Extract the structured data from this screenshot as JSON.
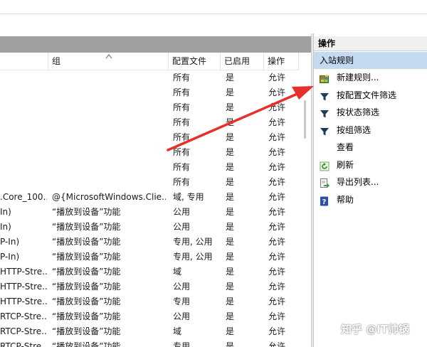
{
  "columns": {
    "group": "组",
    "profile": "配置文件",
    "enabled": "已启用",
    "action": "操作"
  },
  "rows": [
    {
      "name": "",
      "group": "",
      "profile": "所有",
      "enabled": "是",
      "action": "允许"
    },
    {
      "name": "",
      "group": "",
      "profile": "所有",
      "enabled": "是",
      "action": "允许"
    },
    {
      "name": "",
      "group": "",
      "profile": "所有",
      "enabled": "是",
      "action": "允许"
    },
    {
      "name": "",
      "group": "",
      "profile": "所有",
      "enabled": "是",
      "action": "允许"
    },
    {
      "name": "",
      "group": "",
      "profile": "所有",
      "enabled": "是",
      "action": "允许"
    },
    {
      "name": "",
      "group": "",
      "profile": "所有",
      "enabled": "是",
      "action": "允许"
    },
    {
      "name": "",
      "group": "",
      "profile": "所有",
      "enabled": "是",
      "action": "允许"
    },
    {
      "name": "",
      "group": "",
      "profile": "所有",
      "enabled": "是",
      "action": "允许"
    },
    {
      "name": ".Core_100...",
      "group": "@{MicrosoftWindows.Clie...",
      "profile": "域, 专用",
      "enabled": "是",
      "action": "允许"
    },
    {
      "name": "In)",
      "group": "“播放到设备”功能",
      "profile": "公用",
      "enabled": "是",
      "action": "允许"
    },
    {
      "name": "In)",
      "group": "“播放到设备”功能",
      "profile": "公用",
      "enabled": "是",
      "action": "允许"
    },
    {
      "name": "P-In)",
      "group": "“播放到设备”功能",
      "profile": "专用, 公用",
      "enabled": "是",
      "action": "允许"
    },
    {
      "name": "P-In)",
      "group": "“播放到设备”功能",
      "profile": "专用, 公用",
      "enabled": "是",
      "action": "允许"
    },
    {
      "name": "HTTP-Stre...",
      "group": "“播放到设备”功能",
      "profile": "域",
      "enabled": "是",
      "action": "允许"
    },
    {
      "name": "HTTP-Stre...",
      "group": "“播放到设备”功能",
      "profile": "公用",
      "enabled": "是",
      "action": "允许"
    },
    {
      "name": "HTTP-Stre...",
      "group": "“播放到设备”功能",
      "profile": "专用",
      "enabled": "是",
      "action": "允许"
    },
    {
      "name": "RTCP-Stre...",
      "group": "“播放到设备”功能",
      "profile": "公用",
      "enabled": "是",
      "action": "允许"
    },
    {
      "name": "RTCP-Stre...",
      "group": "“播放到设备”功能",
      "profile": "域",
      "enabled": "是",
      "action": "允许"
    },
    {
      "name": "RTCP-Stre...",
      "group": "“播放到设备”功能",
      "profile": "专用",
      "enabled": "是",
      "action": "允许"
    }
  ],
  "actions_pane": {
    "title": "操作",
    "section": "入站规则",
    "items": [
      {
        "label": "新建规则...",
        "icon": "new-rule-icon"
      },
      {
        "label": "按配置文件筛选",
        "icon": "filter-icon"
      },
      {
        "label": "按状态筛选",
        "icon": "filter-icon"
      },
      {
        "label": "按组筛选",
        "icon": "filter-icon"
      },
      {
        "label": "查看",
        "icon": ""
      },
      {
        "label": "刷新",
        "icon": "refresh-icon"
      },
      {
        "label": "导出列表...",
        "icon": "export-icon"
      },
      {
        "label": "帮助",
        "icon": "help-icon"
      }
    ]
  },
  "watermark": "知乎 @IT帅锅",
  "colors": {
    "section_bg": "#c4daf1",
    "arrow": "#e8302a",
    "pane_header": "#a0a0a0"
  }
}
